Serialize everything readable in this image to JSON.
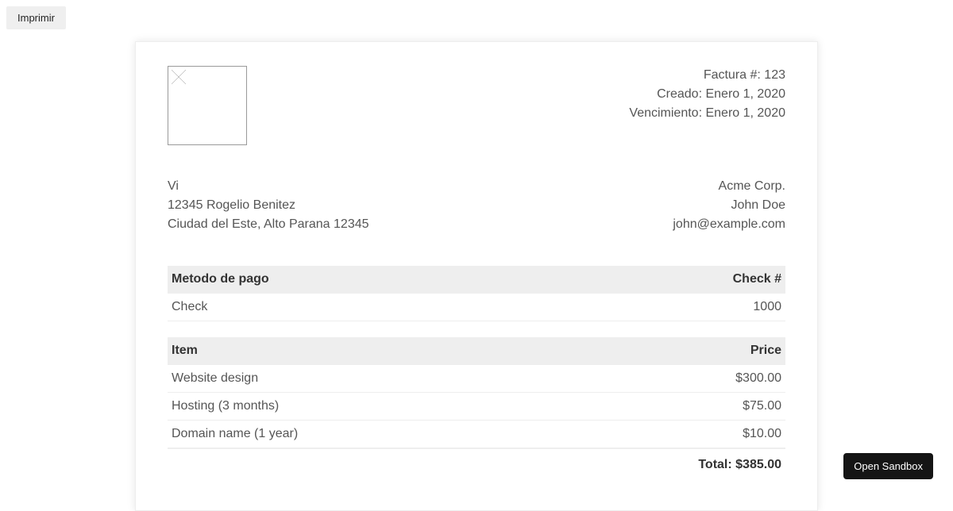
{
  "buttons": {
    "print": "Imprimir",
    "open_sandbox": "Open Sandbox"
  },
  "invoice": {
    "number_label": "Factura #:",
    "number": "123",
    "created_label": "Creado:",
    "created": "Enero 1, 2020",
    "due_label": "Vencimiento:",
    "due": "Enero 1, 2020"
  },
  "from": {
    "name": "Vi",
    "street": "12345 Rogelio Benitez",
    "city": "Ciudad del Este, Alto Parana 12345"
  },
  "to": {
    "name": "Acme Corp.",
    "person": "John Doe",
    "email": "john@example.com"
  },
  "payment": {
    "method_label": "Metodo de pago",
    "check_label": "Check #",
    "method": "Check",
    "check_num": "1000"
  },
  "items": {
    "item_label": "Item",
    "price_label": "Price",
    "rows": [
      {
        "name": "Website design",
        "price": "$300.00"
      },
      {
        "name": "Hosting (3 months)",
        "price": "$75.00"
      },
      {
        "name": "Domain name (1 year)",
        "price": "$10.00"
      }
    ],
    "total_label": "Total:",
    "total": "$385.00"
  }
}
